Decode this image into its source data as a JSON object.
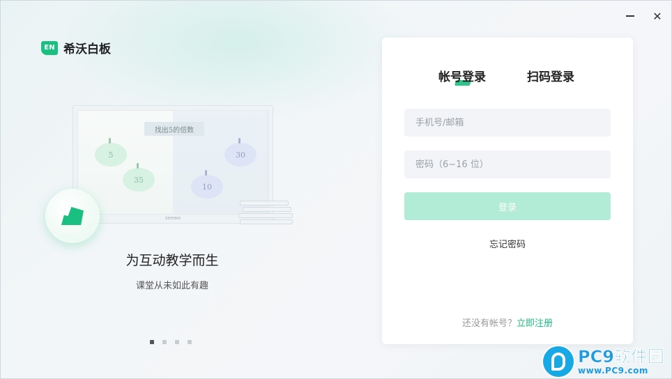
{
  "window": {
    "minimize_icon": "minimize-icon",
    "close_icon": "close-icon",
    "close_glyph": "✕"
  },
  "brand": {
    "badge": "EN",
    "name": "希沃白板",
    "accent": "#1bbf80"
  },
  "illustration": {
    "board_title": "找出5的倍数",
    "apples": [
      "5",
      "30",
      "35",
      "10"
    ],
    "board_brand": "seewo"
  },
  "carousel": {
    "title": "为互动教学而生",
    "subtitle": "课堂从未如此有趣",
    "page_count": 4,
    "active_index": 0
  },
  "login": {
    "tab_account": "帐号登录",
    "tab_scan": "扫码登录",
    "phone_placeholder": "手机号/邮箱",
    "password_placeholder": "密码（6~16 位）",
    "login_button": "登录",
    "forgot_password": "忘记密码",
    "no_account_text": "还没有帐号？",
    "register_link": "立即注册"
  },
  "watermark": {
    "title": "PC9软件园",
    "url": "www.PC9.com"
  }
}
